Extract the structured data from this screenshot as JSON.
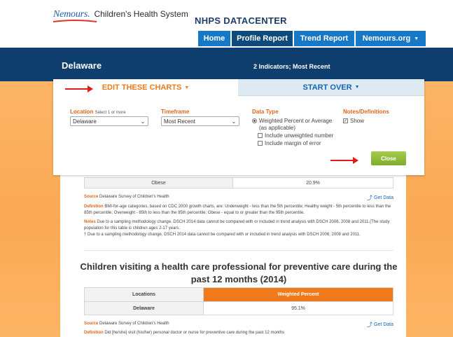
{
  "brand": {
    "logo_text": "Nemours.",
    "system_name": "Children's Health System",
    "app_title": "NHPS DATACENTER"
  },
  "nav": [
    {
      "label": "Home",
      "active": false,
      "dropdown": false
    },
    {
      "label": "Profile Report",
      "active": true,
      "dropdown": false
    },
    {
      "label": "Trend Report",
      "active": false,
      "dropdown": false
    },
    {
      "label": "Nemours.org",
      "active": false,
      "dropdown": true
    }
  ],
  "banner": {
    "state": "Delaware",
    "indicators": "2 Indicators; Most Recent"
  },
  "panel": {
    "edit_tab": "EDIT THESE CHARTS",
    "start_tab": "START OVER",
    "location": {
      "label": "Location",
      "hint": "Select 1 or more",
      "value": "Delaware"
    },
    "timeframe": {
      "label": "Timeframe",
      "value": "Most Recent"
    },
    "data_type": {
      "label": "Data Type",
      "radio_label": "Weighted Percent or Average (as applicable)",
      "opt_unweighted": "Include unweighted number",
      "opt_margin": "Include margin of error"
    },
    "notes": {
      "label": "Notes/Definitions",
      "show_label": "Show",
      "checked": true
    },
    "close_label": "Close"
  },
  "section1": {
    "row_label": "Obese",
    "row_value": "20.9%",
    "source_label": "Source",
    "source_text": "Delaware Survey of Children's Health",
    "get_data": "Get Data",
    "definition_label": "Definition",
    "definition_text": "BMI-for-age categories, based on CDC 2000 growth charts, are: Underweight - less than the 5th percentile; Healthy weight - 5th percentile to less than the 85th percentile; Overweight - 85th to less than the 95th percentile; Obese - equal to or greater than the 95th percentile.",
    "notes_label": "Notes",
    "notes_text": "Due to a sampling methodology change, DSCH 2014 data cannot be compared with or included in trend analysis with DSCH 2006, 2008 and 2011.(The study population for this table is children ages 2-17 years.",
    "dagger_text": "† Due to a sampling methodology change, DSCH 2014 data cannot be compared with or included in trend analysis with DSCH 2006, 2008 and 2011."
  },
  "section2": {
    "title": "Children visiting a health care professional for preventive care during the past 12 months (2014)",
    "col_locations": "Locations",
    "col_weighted": "Weighted Percent",
    "row_location": "Delaware",
    "row_value": "95.1%",
    "source_label": "Source",
    "source_text": "Delaware Survey of Children's Health",
    "get_data": "Get Data",
    "definition_label": "Definition",
    "definition_text": "Did [he/she] visit (his/her) personal doctor or nurse for preventive care during the past 12 months"
  },
  "colors": {
    "nav_blue": "#1778c6",
    "nav_active": "#0f4a7c",
    "banner_navy": "#0d3e6d",
    "accent_orange": "#f07a1b",
    "close_green": "#8cb93a",
    "arrow_red": "#e31b1b"
  }
}
